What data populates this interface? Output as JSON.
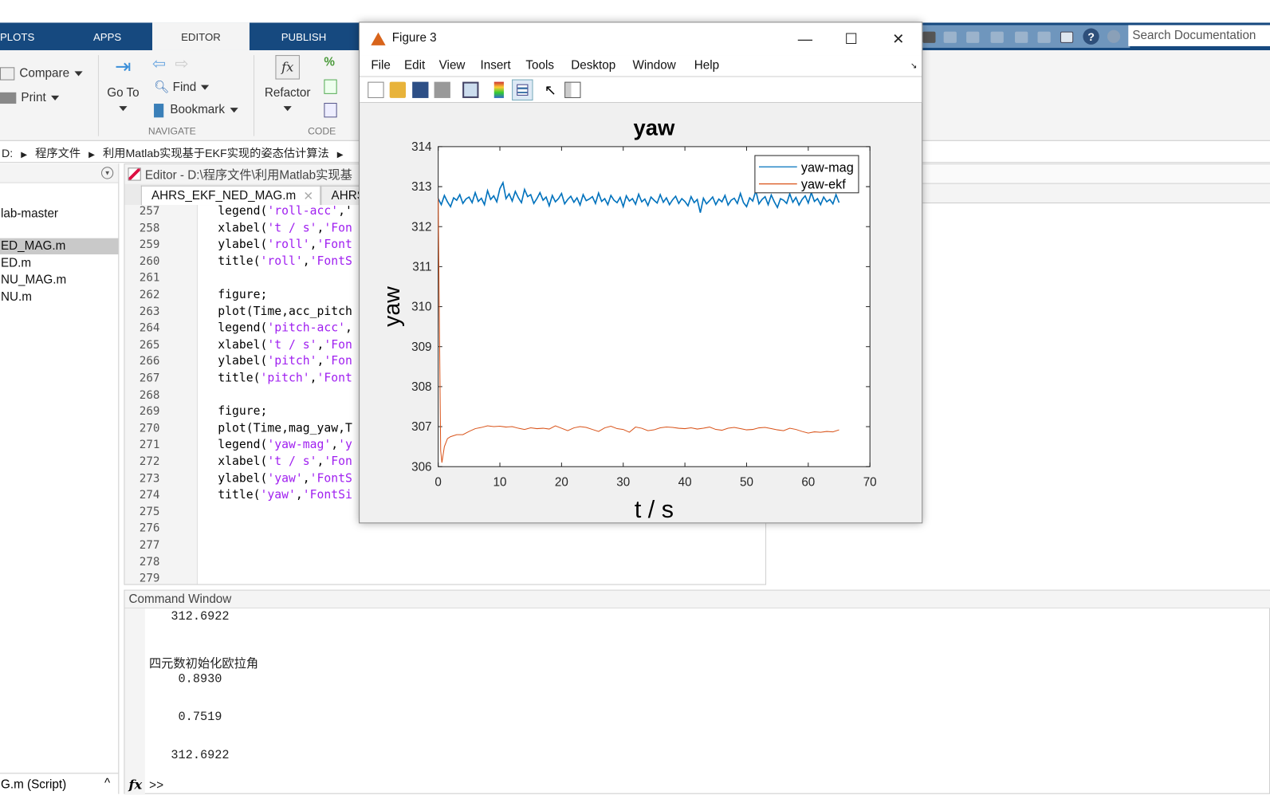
{
  "toolstrip": {
    "tabs": [
      "PLOTS",
      "APPS",
      "EDITOR",
      "PUBLISH"
    ],
    "selected_tab": "EDITOR",
    "search_placeholder": "Search Documentation",
    "compare": "Compare",
    "print": "Print",
    "goto": "Go To",
    "find": "Find",
    "bookmark": "Bookmark",
    "refactor": "Refactor",
    "navigate_group": "NAVIGATE",
    "code_group": "CODE"
  },
  "address": {
    "drive": "D:",
    "folders": [
      "程序文件",
      "利用Matlab实现基于EKF实现的姿态估计算法"
    ]
  },
  "current_folder": {
    "items": [
      "lab-master",
      "ED_MAG.m",
      "ED.m",
      "NU_MAG.m",
      "NU.m"
    ],
    "selected": "ED_MAG.m",
    "details": "G.m  (Script)"
  },
  "editor": {
    "title": "Editor - D:\\程序文件\\利用Matlab实现基",
    "tabs": [
      "AHRS_EKF_NED_MAG.m",
      "AHRS"
    ],
    "lines": [
      {
        "n": "257",
        "seg": [
          [
            "legend(",
            0
          ],
          [
            "'roll-acc'",
            1
          ],
          [
            ",'",
            0
          ]
        ]
      },
      {
        "n": "258",
        "seg": [
          [
            "xlabel(",
            0
          ],
          [
            "'t / s'",
            1
          ],
          [
            ",",
            0
          ],
          [
            "'Fon",
            1
          ]
        ]
      },
      {
        "n": "259",
        "seg": [
          [
            "ylabel(",
            0
          ],
          [
            "'roll'",
            1
          ],
          [
            ",",
            0
          ],
          [
            "'Font",
            1
          ]
        ]
      },
      {
        "n": "260",
        "seg": [
          [
            "title(",
            0
          ],
          [
            "'roll'",
            1
          ],
          [
            ",",
            0
          ],
          [
            "'FontS",
            1
          ]
        ]
      },
      {
        "n": "261",
        "seg": []
      },
      {
        "n": "262",
        "seg": [
          [
            "figure;",
            0
          ]
        ]
      },
      {
        "n": "263",
        "seg": [
          [
            "plot(Time,acc_pitch",
            0
          ]
        ]
      },
      {
        "n": "264",
        "seg": [
          [
            "legend(",
            0
          ],
          [
            "'pitch-acc'",
            1
          ],
          [
            ",",
            0
          ]
        ]
      },
      {
        "n": "265",
        "seg": [
          [
            "xlabel(",
            0
          ],
          [
            "'t / s'",
            1
          ],
          [
            ",",
            0
          ],
          [
            "'Fon",
            1
          ]
        ]
      },
      {
        "n": "266",
        "seg": [
          [
            "ylabel(",
            0
          ],
          [
            "'pitch'",
            1
          ],
          [
            ",",
            0
          ],
          [
            "'Fon",
            1
          ]
        ]
      },
      {
        "n": "267",
        "seg": [
          [
            "title(",
            0
          ],
          [
            "'pitch'",
            1
          ],
          [
            ",",
            0
          ],
          [
            "'Font",
            1
          ]
        ]
      },
      {
        "n": "268",
        "seg": []
      },
      {
        "n": "269",
        "seg": [
          [
            "figure;",
            0
          ]
        ]
      },
      {
        "n": "270",
        "seg": [
          [
            "plot(Time,mag_yaw,T",
            0
          ]
        ]
      },
      {
        "n": "271",
        "seg": [
          [
            "legend(",
            0
          ],
          [
            "'yaw-mag'",
            1
          ],
          [
            ",",
            0
          ],
          [
            "'y",
            1
          ]
        ]
      },
      {
        "n": "272",
        "seg": [
          [
            "xlabel(",
            0
          ],
          [
            "'t / s'",
            1
          ],
          [
            ",",
            0
          ],
          [
            "'Fon",
            1
          ]
        ]
      },
      {
        "n": "273",
        "seg": [
          [
            "ylabel(",
            0
          ],
          [
            "'yaw'",
            1
          ],
          [
            ",",
            0
          ],
          [
            "'FontS",
            1
          ]
        ]
      },
      {
        "n": "274",
        "seg": [
          [
            "title(",
            0
          ],
          [
            "'yaw'",
            1
          ],
          [
            ",",
            0
          ],
          [
            "'FontSi",
            1
          ]
        ]
      },
      {
        "n": "275",
        "seg": []
      },
      {
        "n": "276",
        "seg": []
      },
      {
        "n": "277",
        "seg": []
      },
      {
        "n": "278",
        "seg": []
      },
      {
        "n": "279",
        "seg": []
      }
    ]
  },
  "command_window": {
    "title": "Command Window",
    "lines": [
      "   312.6922",
      "",
      "四元数初始化欧拉角",
      "    0.8930",
      "",
      "    0.7519",
      "",
      "   312.6922"
    ],
    "prompt": ">>"
  },
  "figure": {
    "title": "Figure 3",
    "menu": [
      "File",
      "Edit",
      "View",
      "Insert",
      "Tools",
      "Desktop",
      "Window",
      "Help"
    ],
    "toolbar_icons": [
      "new-figure-icon",
      "open-icon",
      "save-icon",
      "print-icon",
      "link-plot-icon",
      "colorbar-icon",
      "legend-icon",
      "edit-plot-icon",
      "property-inspector-icon"
    ]
  },
  "chart_data": {
    "type": "line",
    "title": "yaw",
    "xlabel": "t / s",
    "ylabel": "yaw",
    "xlim": [
      0,
      70
    ],
    "ylim": [
      306,
      314
    ],
    "xticks": [
      "0",
      "10",
      "20",
      "30",
      "40",
      "50",
      "60",
      "70"
    ],
    "yticks": [
      "306",
      "307",
      "308",
      "309",
      "310",
      "311",
      "312",
      "313",
      "314"
    ],
    "grid": false,
    "legend_position": "top-right",
    "series": [
      {
        "name": "yaw-mag",
        "color": "#0072bd",
        "x_start": 0,
        "x_step": 0.5,
        "y": [
          312.7,
          312.55,
          312.78,
          312.62,
          312.5,
          312.72,
          312.66,
          312.8,
          312.58,
          312.69,
          312.74,
          312.6,
          312.85,
          312.63,
          312.71,
          312.55,
          312.9,
          312.68,
          312.77,
          312.62,
          312.95,
          313.1,
          312.7,
          312.82,
          312.64,
          312.88,
          312.72,
          312.6,
          312.93,
          312.75,
          312.8,
          312.58,
          312.7,
          312.85,
          312.66,
          312.74,
          312.52,
          312.78,
          312.62,
          312.7,
          312.83,
          312.57,
          312.68,
          312.76,
          312.61,
          312.72,
          312.54,
          312.8,
          312.65,
          312.69,
          312.75,
          312.58,
          312.84,
          312.63,
          312.7,
          312.55,
          312.78,
          312.66,
          312.6,
          312.73,
          312.5,
          312.77,
          312.64,
          312.7,
          312.56,
          312.81,
          312.62,
          312.69,
          312.53,
          312.74,
          312.66,
          312.59,
          312.8,
          312.61,
          312.72,
          312.55,
          312.67,
          312.76,
          312.58,
          312.7,
          312.63,
          312.52,
          312.75,
          312.6,
          312.68,
          312.35,
          312.71,
          312.57,
          312.65,
          312.74,
          312.55,
          312.69,
          312.62,
          312.78,
          312.54,
          312.66,
          312.71,
          312.58,
          312.83,
          312.6,
          312.5,
          312.72,
          312.64,
          312.9,
          312.57,
          312.68,
          312.75,
          312.55,
          312.79,
          312.62,
          312.48,
          312.7,
          312.66,
          312.58,
          312.82,
          312.61,
          312.73,
          312.54,
          312.68,
          312.77,
          312.59,
          312.85,
          312.63,
          312.7,
          312.55,
          312.74,
          312.62,
          312.68,
          312.57,
          312.8,
          312.6
        ]
      },
      {
        "name": "yaw-ekf",
        "color": "#d95319",
        "points": [
          [
            0,
            312.7
          ],
          [
            0.2,
            309.5
          ],
          [
            0.4,
            306.4
          ],
          [
            0.6,
            306.1
          ],
          [
            1,
            306.5
          ],
          [
            1.5,
            306.7
          ],
          [
            2,
            306.75
          ],
          [
            3,
            306.8
          ],
          [
            4,
            306.8
          ],
          [
            5,
            306.88
          ],
          [
            6,
            306.95
          ],
          [
            7,
            306.98
          ],
          [
            8,
            307.02
          ],
          [
            9,
            307.0
          ],
          [
            10,
            307.01
          ],
          [
            11,
            306.99
          ],
          [
            12,
            307.0
          ],
          [
            13,
            306.96
          ],
          [
            14,
            306.93
          ],
          [
            15,
            306.97
          ],
          [
            16,
            306.95
          ],
          [
            17,
            306.96
          ],
          [
            18,
            306.94
          ],
          [
            19,
            307.02
          ],
          [
            20,
            306.96
          ],
          [
            21,
            306.9
          ],
          [
            22,
            306.97
          ],
          [
            23,
            307.0
          ],
          [
            24,
            306.98
          ],
          [
            25,
            306.93
          ],
          [
            26,
            306.88
          ],
          [
            27,
            306.97
          ],
          [
            28,
            307.01
          ],
          [
            29,
            306.95
          ],
          [
            30,
            306.93
          ],
          [
            31,
            306.86
          ],
          [
            32,
            306.99
          ],
          [
            33,
            306.96
          ],
          [
            34,
            306.9
          ],
          [
            35,
            306.92
          ],
          [
            36,
            306.97
          ],
          [
            37,
            306.99
          ],
          [
            38,
            306.98
          ],
          [
            39,
            306.96
          ],
          [
            40,
            306.95
          ],
          [
            41,
            306.97
          ],
          [
            42,
            306.94
          ],
          [
            43,
            306.96
          ],
          [
            44,
            306.99
          ],
          [
            45,
            306.93
          ],
          [
            46,
            306.91
          ],
          [
            47,
            306.96
          ],
          [
            48,
            306.98
          ],
          [
            49,
            306.95
          ],
          [
            50,
            306.92
          ],
          [
            51,
            306.93
          ],
          [
            52,
            306.97
          ],
          [
            53,
            306.98
          ],
          [
            54,
            306.95
          ],
          [
            55,
            306.92
          ],
          [
            56,
            306.9
          ],
          [
            57,
            306.96
          ],
          [
            58,
            306.93
          ],
          [
            59,
            306.88
          ],
          [
            60,
            306.84
          ],
          [
            61,
            306.87
          ],
          [
            62,
            306.86
          ],
          [
            63,
            306.88
          ],
          [
            64,
            306.87
          ],
          [
            65,
            306.92
          ]
        ]
      }
    ]
  }
}
